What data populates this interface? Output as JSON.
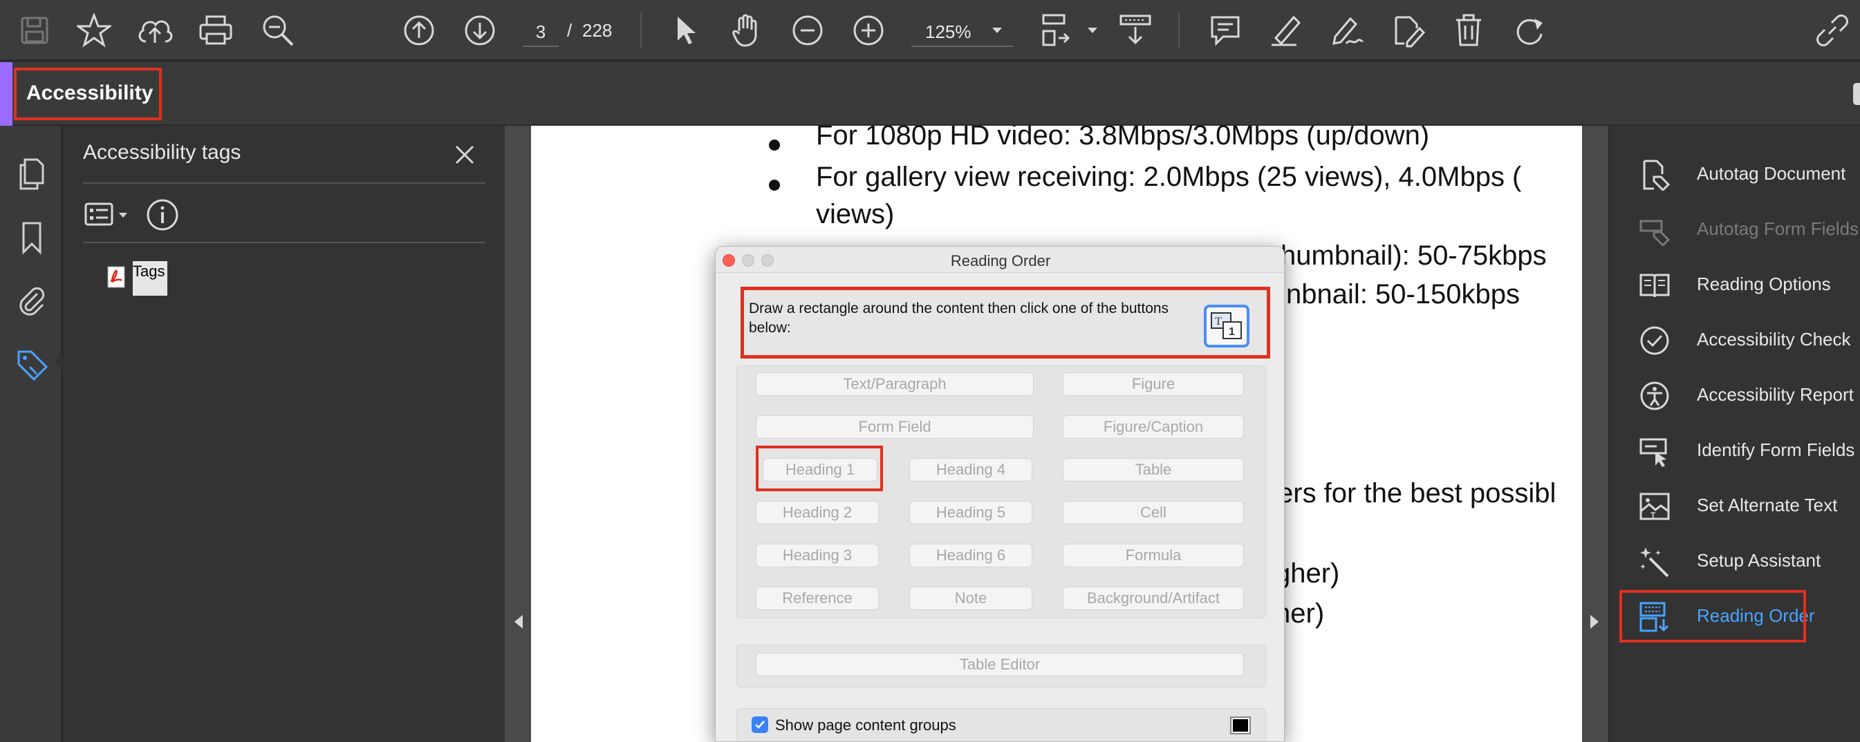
{
  "toolbar": {
    "page_current": "3",
    "page_separator": "/",
    "page_total": "228",
    "zoom": "125%"
  },
  "tool": {
    "title": "Accessibility"
  },
  "tags_panel": {
    "title": "Accessibility tags",
    "root_label": "Tags"
  },
  "document": {
    "lines": [
      "For 1080p HD video: 3.8Mbps/3.0Mbps (up/down)",
      "For gallery view receiving: 2.0Mbps (25 views), 4.0Mbps (",
      "views)",
      "humbnail): 50-75kbps",
      "nbnail: 50-150kbps",
      "ers for the best possibl",
      "gher)",
      "ner)"
    ]
  },
  "dialog": {
    "title": "Reading Order",
    "instruction": "Draw a rectangle around the content then click one of the buttons below:",
    "buttons": {
      "text_paragraph": "Text/Paragraph",
      "figure": "Figure",
      "form_field": "Form Field",
      "figure_caption": "Figure/Caption",
      "heading1": "Heading 1",
      "heading4": "Heading 4",
      "table": "Table",
      "heading2": "Heading 2",
      "heading5": "Heading 5",
      "cell": "Cell",
      "heading3": "Heading 3",
      "heading6": "Heading 6",
      "formula": "Formula",
      "reference": "Reference",
      "note": "Note",
      "background_artifact": "Background/Artifact",
      "table_editor": "Table Editor"
    },
    "show_page_content_groups": "Show page content groups"
  },
  "right_panel": {
    "items": [
      {
        "label": "Autotag Document",
        "state": "normal",
        "icon": "autotag-document-icon"
      },
      {
        "label": "Autotag Form Fields",
        "state": "disabled",
        "icon": "autotag-form-fields-icon"
      },
      {
        "label": "Reading Options",
        "state": "normal",
        "icon": "reading-options-icon"
      },
      {
        "label": "Accessibility Check",
        "state": "normal",
        "icon": "accessibility-check-icon"
      },
      {
        "label": "Accessibility Report",
        "state": "normal",
        "icon": "accessibility-report-icon"
      },
      {
        "label": "Identify Form Fields",
        "state": "normal",
        "icon": "identify-form-fields-icon"
      },
      {
        "label": "Set Alternate Text",
        "state": "normal",
        "icon": "set-alternate-text-icon"
      },
      {
        "label": "Setup Assistant",
        "state": "normal",
        "icon": "setup-assistant-icon"
      },
      {
        "label": "Reading Order",
        "state": "active",
        "icon": "reading-order-icon"
      }
    ]
  },
  "colors": {
    "highlight": "#e0301e",
    "accent": "#9b6bff",
    "active": "#4aa3ff",
    "checkbox": "#3a82f7"
  }
}
